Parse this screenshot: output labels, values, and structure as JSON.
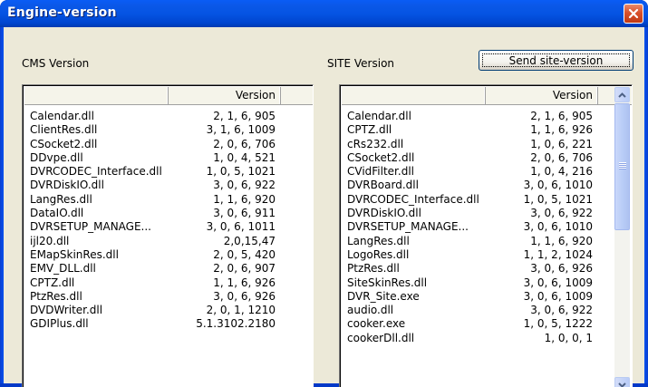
{
  "window": {
    "title": "Engine-version"
  },
  "cms": {
    "label": "CMS Version",
    "header_version": "Version",
    "rows": [
      {
        "name": "Calendar.dll",
        "version": "2, 1, 6, 905"
      },
      {
        "name": "ClientRes.dll",
        "version": "3, 1, 6, 1009"
      },
      {
        "name": "CSocket2.dll",
        "version": "2, 0, 6, 706"
      },
      {
        "name": "DDvpe.dll",
        "version": "1, 0, 4, 521"
      },
      {
        "name": "DVRCODEC_Interface.dll",
        "version": "1, 0, 5, 1021"
      },
      {
        "name": "DVRDiskIO.dll",
        "version": "3, 0, 6, 922"
      },
      {
        "name": "LangRes.dll",
        "version": "1, 1, 6, 920"
      },
      {
        "name": "DataIO.dll",
        "version": "3, 0, 6, 911"
      },
      {
        "name": "DVRSETUP_MANAGE...",
        "version": "3, 0, 6, 1011"
      },
      {
        "name": "ijl20.dll",
        "version": "2,0,15,47"
      },
      {
        "name": "EMapSkinRes.dll",
        "version": "2, 0, 5, 420"
      },
      {
        "name": "EMV_DLL.dll",
        "version": "2, 0, 6, 907"
      },
      {
        "name": "CPTZ.dll",
        "version": "1, 1, 6, 926"
      },
      {
        "name": "PtzRes.dll",
        "version": "3, 0, 6, 926"
      },
      {
        "name": "DVDWriter.dll",
        "version": "2, 0, 1, 1210"
      },
      {
        "name": "GDIPlus.dll",
        "version": "5.1.3102.2180"
      }
    ]
  },
  "site": {
    "label": "SITE Version",
    "send_button": "Send site-version",
    "header_version": "Version",
    "rows": [
      {
        "name": "Calendar.dll",
        "version": "2, 1, 6, 905"
      },
      {
        "name": "CPTZ.dll",
        "version": "1, 1, 6, 926"
      },
      {
        "name": "cRs232.dll",
        "version": "1, 0, 6, 221"
      },
      {
        "name": "CSocket2.dll",
        "version": "2, 0, 6, 706"
      },
      {
        "name": "CVidFilter.dll",
        "version": "1, 0, 4, 216"
      },
      {
        "name": "DVRBoard.dll",
        "version": "3, 0, 6, 1010"
      },
      {
        "name": "DVRCODEC_Interface.dll",
        "version": "1, 0, 5, 1021"
      },
      {
        "name": "DVRDiskIO.dll",
        "version": "3, 0, 6, 922"
      },
      {
        "name": "DVRSETUP_MANAGE...",
        "version": "3, 0, 6, 1010"
      },
      {
        "name": "LangRes.dll",
        "version": "1, 1, 6, 920"
      },
      {
        "name": "LogoRes.dll",
        "version": "1, 1, 2, 1024"
      },
      {
        "name": "PtzRes.dll",
        "version": "3, 0, 6, 926"
      },
      {
        "name": "SiteSkinRes.dll",
        "version": "3, 0, 6, 1009"
      },
      {
        "name": "DVR_Site.exe",
        "version": "3, 0, 6, 1009"
      },
      {
        "name": "audio.dll",
        "version": "3, 0, 6, 922"
      },
      {
        "name": "cooker.exe",
        "version": "1, 0, 5, 1222"
      },
      {
        "name": "cookerDll.dll",
        "version": "1, 0, 0, 1"
      }
    ]
  },
  "icons": {
    "close": "close-icon",
    "scroll_up": "chevron-up-icon",
    "scroll_down": "chevron-down-icon"
  },
  "colors": {
    "titlebar": "#0554e3",
    "close_button": "#d9512c",
    "dialog_background": "#ece9d8",
    "scrollbar_accent": "#b9ccf7"
  }
}
